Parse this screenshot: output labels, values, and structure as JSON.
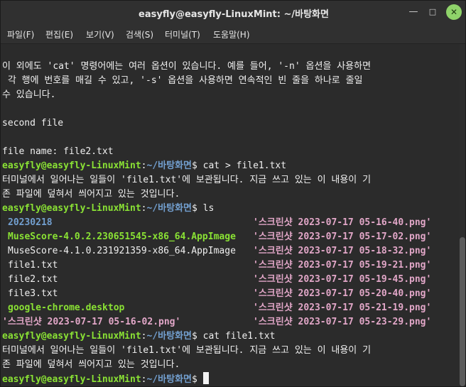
{
  "window": {
    "title": "easyfly@easyfly-LinuxMint: ~/바탕화면"
  },
  "window_buttons": {
    "minimize": "—",
    "maximize": "□",
    "close": "✕"
  },
  "menu": [
    "파일(F)",
    "편집(E)",
    "보기(V)",
    "검색(S)",
    "터미널(T)",
    "도움말(H)"
  ],
  "terminal": {
    "text_lines": {
      "l1": "이 외에도 'cat' 명령어에는 여러 옵션이 있습니다. 예를 들어, '-n' 옵션을 사용하면",
      "l2": " 각 행에 번호를 매길 수 있고, '-s' 옵션을 사용하면 연속적인 빈 줄을 하나로 줄일",
      "l3": "수 있습니다.",
      "l5": "second file",
      "l7": "file name: file2.txt",
      "l9": "터미널에서 일어나는 일들이 'file1.txt'에 보관됩니다. 지금 쓰고 있는 이 내용이 기",
      "l10": "존 파일에 덮혀서 씌어지고 있는 것입니다.",
      "l21": "터미널에서 일어나는 일들이 'file1.txt'에 보관됩니다. 지금 쓰고 있는 이 내용이 기",
      "l22": "존 파일에 덮혀서 씌어지고 있는 것입니다."
    },
    "prompt": {
      "user_host": "easyfly@easyfly-LinuxMint",
      "colon": ":",
      "path": "~/바탕화면",
      "dollar": "$ "
    },
    "commands": [
      "cat > file1.txt",
      "ls",
      "cat file1.txt",
      ""
    ],
    "ls": {
      "left": [
        "20230218",
        "MuseScore-4.0.2.230651545-x86_64.AppImage",
        "MuseScore-4.1.0.231921359-x86_64.AppImage",
        "file1.txt",
        "file2.txt",
        "file3.txt",
        "google-chrome.desktop",
        "'스크린샷 2023-07-17 05-16-02.png'"
      ],
      "right": [
        "'스크린샷 2023-07-17 05-16-40.png'",
        "'스크린샷 2023-07-17 05-17-02.png'",
        "'스크린샷 2023-07-17 05-18-32.png'",
        "'스크린샷 2023-07-17 05-19-21.png'",
        "'스크린샷 2023-07-17 05-19-45.png'",
        "'스크린샷 2023-07-17 05-20-40.png'",
        "'스크린샷 2023-07-17 05-21-19.png'",
        "'스크린샷 2023-07-17 05-23-29.png'"
      ]
    }
  },
  "colors": {
    "prompt": "#8ae234",
    "path": "#729fcf",
    "directory": "#729fcf",
    "executable": "#8ae234",
    "image": "#e2a7c8",
    "background": "#2b2b2b"
  }
}
